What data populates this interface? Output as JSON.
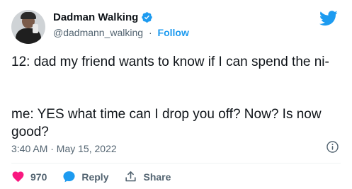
{
  "author": {
    "name": "Dadman Walking",
    "handle": "@dadmann_walking",
    "separator": "·",
    "follow_label": "Follow"
  },
  "tweet": {
    "paragraph_1": "12: dad my friend wants to know if I can spend the ni-",
    "paragraph_2": "me: YES what time can I drop you off? Now? Is now good?",
    "timestamp": "3:40 AM · May 15, 2022"
  },
  "actions": {
    "likes": "970",
    "reply_label": "Reply",
    "share_label": "Share"
  },
  "icons": {
    "verified": "verified-badge-icon",
    "brand": "twitter-bird-icon",
    "info": "info-icon",
    "like": "heart-icon",
    "reply": "speech-bubble-icon",
    "share": "share-icon"
  },
  "colors": {
    "accent": "#1d9bf0",
    "like": "#f91880",
    "text": "#0f1419",
    "muted": "#536471"
  }
}
